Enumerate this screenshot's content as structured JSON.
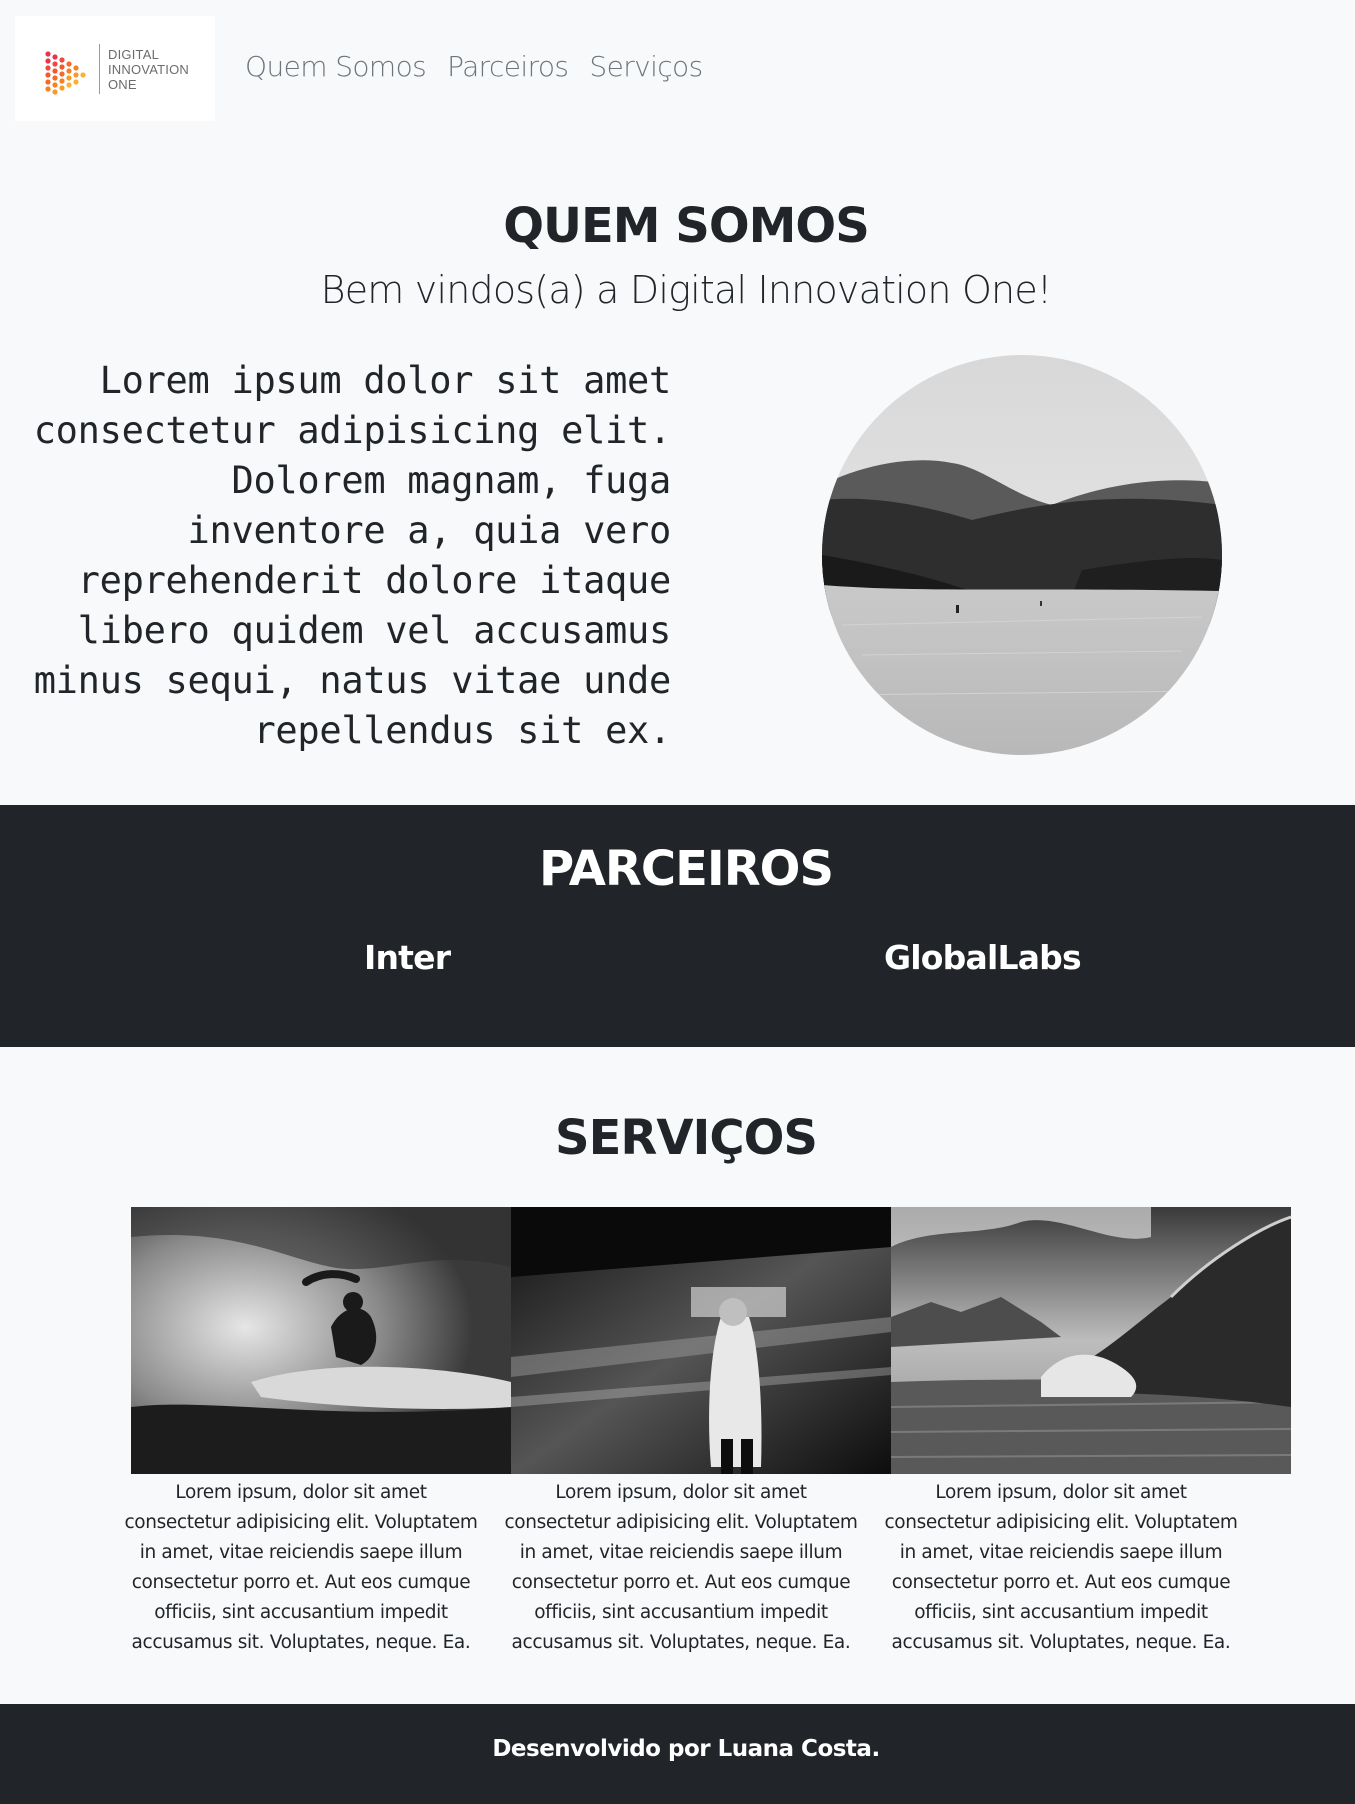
{
  "header": {
    "logo": {
      "line1": "DIGITAL",
      "line2": "INNOVATION",
      "line3": "ONE"
    },
    "nav": [
      {
        "label": "Quem Somos"
      },
      {
        "label": "Parceiros"
      },
      {
        "label": "Serviços"
      }
    ]
  },
  "about": {
    "title": "QUEM SOMOS",
    "subtitle": "Bem vindos(a) a Digital Innovation One!",
    "text": "Lorem ipsum dolor sit amet consectetur adipisicing elit. Dolorem magnam, fuga inventore a, quia vero reprehenderit dolore itaque libero quidem vel accusamus minus sequi, natus vitae unde repellendus sit ex."
  },
  "partners": {
    "title": "PARCEIROS",
    "items": [
      {
        "name": "Inter"
      },
      {
        "name": "GlobalLabs"
      }
    ]
  },
  "services": {
    "title": "SERVIÇOS",
    "items": [
      {
        "text": "Lorem ipsum, dolor sit amet consectetur adipisicing elit. Voluptatem in amet, vitae reiciendis saepe illum consectetur porro et. Aut eos cumque officiis, sint accusantium impedit accusamus sit. Voluptates, neque. Ea."
      },
      {
        "text": "Lorem ipsum, dolor sit amet consectetur adipisicing elit. Voluptatem in amet, vitae reiciendis saepe illum consectetur porro et. Aut eos cumque officiis, sint accusantium impedit accusamus sit. Voluptates, neque. Ea."
      },
      {
        "text": "Lorem ipsum, dolor sit amet consectetur adipisicing elit. Voluptatem in amet, vitae reiciendis saepe illum consectetur porro et. Aut eos cumque officiis, sint accusantium impedit accusamus sit. Voluptates, neque. Ea."
      }
    ]
  },
  "footer": {
    "text": "Desenvolvido por Luana Costa."
  },
  "colors": {
    "page_bg": "#f8f9fa",
    "dark_bg": "#212529",
    "nav_text": "#6c757d",
    "logo_orange": "#f58220",
    "logo_red": "#e8344e",
    "logo_yellow": "#f9b233"
  }
}
